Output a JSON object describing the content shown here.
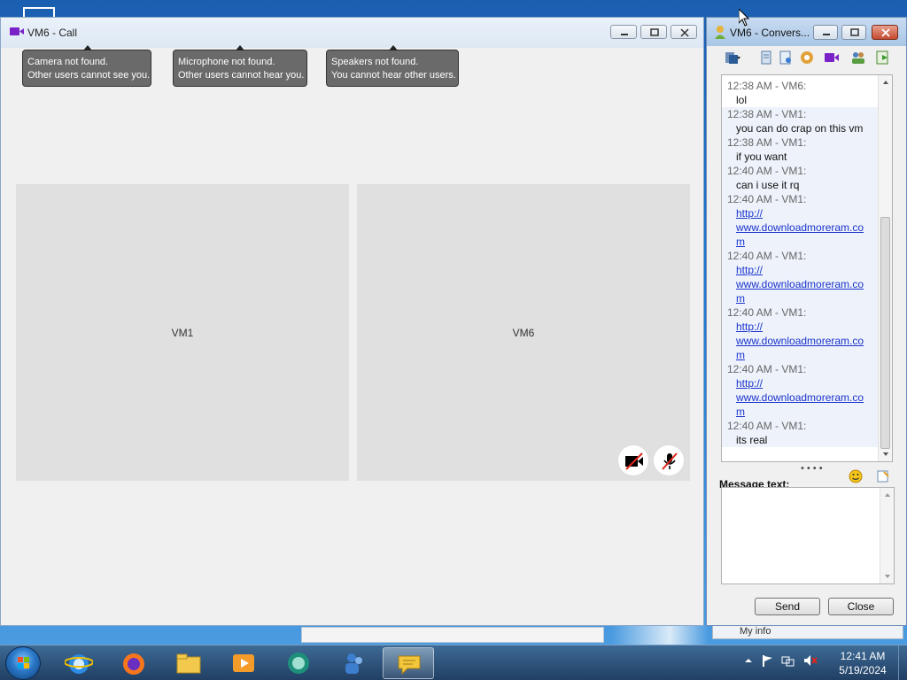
{
  "call_window": {
    "title": "VM6 - Call",
    "notices": [
      {
        "line1": "Camera not found.",
        "line2": "Other users cannot see you."
      },
      {
        "line1": "Microphone not found.",
        "line2": "Other users cannot hear you."
      },
      {
        "line1": "Speakers not found.",
        "line2": "You cannot hear other users."
      }
    ],
    "tiles": [
      {
        "label": "VM1"
      },
      {
        "label": "VM6"
      }
    ]
  },
  "conversation_window": {
    "title": "VM6 - Convers...",
    "messages": [
      {
        "head": "12:38 AM - VM6:",
        "text": "lol",
        "link": false
      },
      {
        "head": "12:38 AM - VM1:",
        "text": "you can do crap on this vm",
        "link": false
      },
      {
        "head": "12:38 AM - VM1:",
        "text": "if you want",
        "link": false
      },
      {
        "head": "12:40 AM - VM1:",
        "text": "can i use it rq",
        "link": false
      },
      {
        "head": "12:40 AM - VM1:",
        "text": "http://www.downloadmoreram.com",
        "link": true,
        "parts": [
          "http://",
          "www.downloadmoreram.co",
          "m"
        ]
      },
      {
        "head": "12:40 AM - VM1:",
        "text": "http://www.downloadmoreram.com",
        "link": true,
        "parts": [
          "http://",
          "www.downloadmoreram.co",
          "m"
        ]
      },
      {
        "head": "12:40 AM - VM1:",
        "text": "http://www.downloadmoreram.com",
        "link": true,
        "parts": [
          "http://",
          "www.downloadmoreram.co",
          "m"
        ]
      },
      {
        "head": "12:40 AM - VM1:",
        "text": "http://www.downloadmoreram.com",
        "link": true,
        "parts": [
          "http://",
          "www.downloadmoreram.co",
          "m"
        ]
      },
      {
        "head": "12:40 AM - VM1:",
        "text": "its real",
        "link": false
      }
    ],
    "message_label": "Message text:",
    "message_value": "",
    "send_label": "Send",
    "close_label": "Close"
  },
  "behind_window": {
    "label": "My info"
  },
  "taskbar": {
    "time": "12:41 AM",
    "date": "5/19/2024"
  },
  "colors": {
    "accent": "#7a22c8",
    "link": "#1a33cc",
    "close_red": "#c44a2e"
  }
}
